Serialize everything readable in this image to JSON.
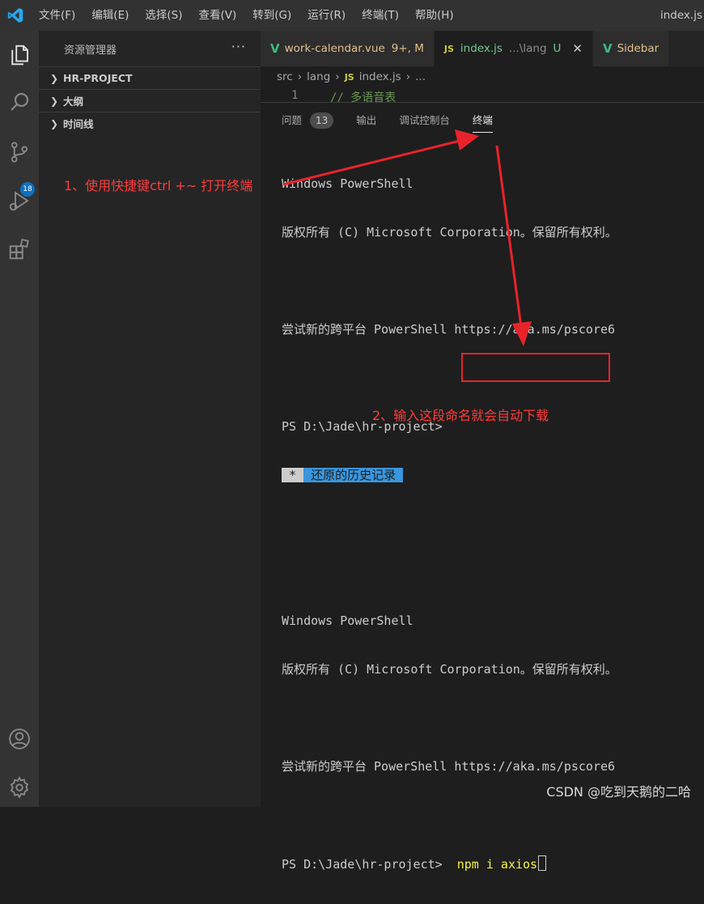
{
  "menu": [
    "文件(F)",
    "编辑(E)",
    "选择(S)",
    "查看(V)",
    "转到(G)",
    "运行(R)",
    "终端(T)",
    "帮助(H)"
  ],
  "window_title": "index.js",
  "activity": {
    "scm_badge": "18"
  },
  "sidebar": {
    "title": "资源管理器",
    "more": "···",
    "sections": [
      "HR-PROJECT",
      "大纲",
      "时间线"
    ]
  },
  "tabs": [
    {
      "label": "work-calendar.vue",
      "status": "9+, M"
    },
    {
      "label": "index.js",
      "detail": "...\\lang",
      "status": "U"
    },
    {
      "label": "Sidebar"
    }
  ],
  "tab_js_badge": "JS",
  "breadcrumb": {
    "parts": [
      "src",
      "lang",
      "index.js",
      "..."
    ]
  },
  "code": {
    "line_number": "1",
    "text": "// 多语音表"
  },
  "panel": {
    "tabs": [
      "问题",
      "输出",
      "调试控制台",
      "终端"
    ],
    "problems_count": "13"
  },
  "terminal": {
    "l1": "Windows PowerShell",
    "l2": "版权所有 (C) Microsoft Corporation。保留所有权利。",
    "l3": "尝试新的跨平台 PowerShell https://aka.ms/pscore6",
    "prompt": "PS D:\\Jade\\hr-project> ",
    "restore_star": " * ",
    "restore_text": " 还原的历史记录 ",
    "command": "npm i axios"
  },
  "annotations": {
    "step1": "1、使用快捷键ctrl +~ 打开终端",
    "step2": "2、输入这段命名就会自动下载",
    "color": "#ff3b3b"
  },
  "watermark": "CSDN @吃到天鹅的二哈"
}
